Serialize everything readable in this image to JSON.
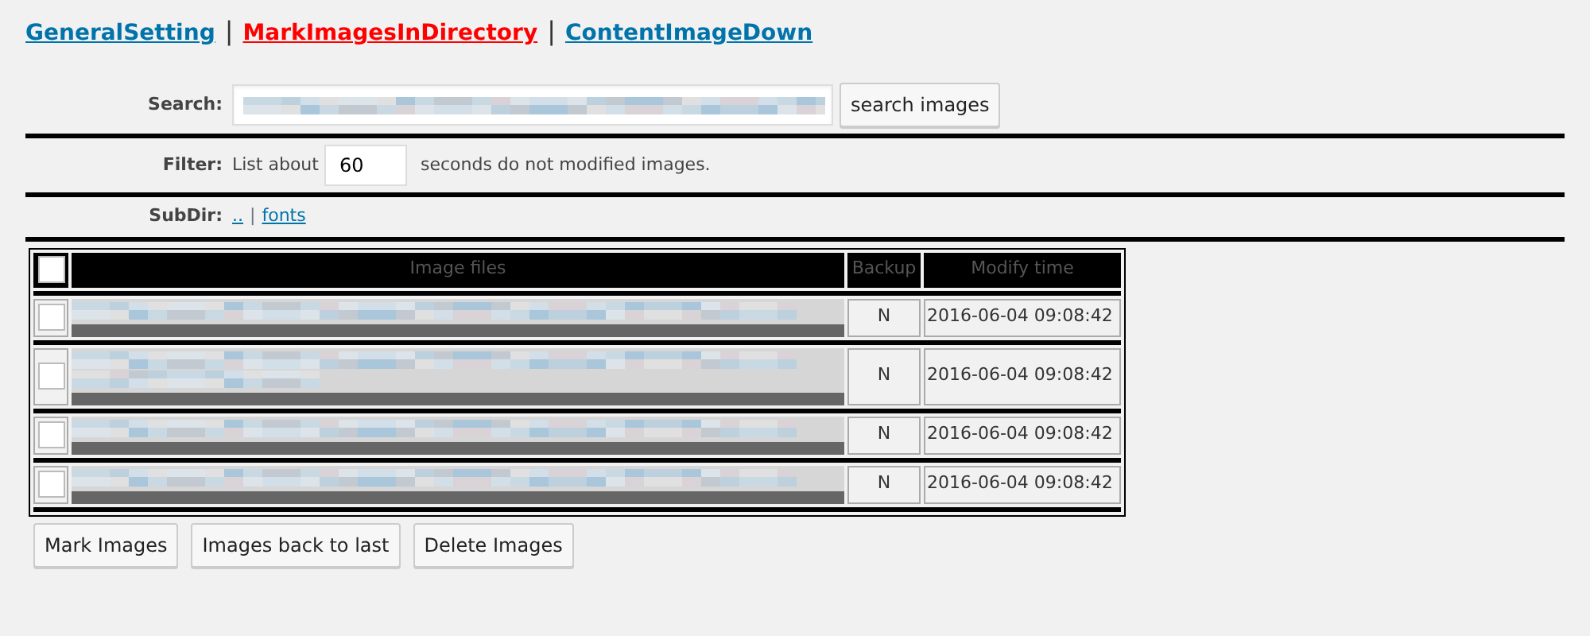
{
  "separator": "|",
  "nav_links": [
    {
      "label": "GeneralSetting",
      "selected": false
    },
    {
      "label": "MarkImagesInDirectory",
      "selected": true
    },
    {
      "label": "ContentImageDown",
      "selected": false
    }
  ],
  "search": {
    "label": "Search:",
    "button": "search images"
  },
  "filter": {
    "label": "Filter:",
    "before": "List about",
    "value": "60",
    "after": "seconds do not modified images."
  },
  "subdir": {
    "label": "SubDir:",
    "links": [
      "..",
      "fonts"
    ]
  },
  "table": {
    "select_all_checked": false,
    "columns": [
      "Image files",
      "Backup",
      "Modify time"
    ],
    "rows": [
      {
        "checked": false,
        "kind": "single",
        "backup": "N",
        "modify_time": "2016-06-04 09:08:42"
      },
      {
        "checked": false,
        "kind": "wrapped",
        "backup": "N",
        "modify_time": "2016-06-04 09:08:42"
      },
      {
        "checked": false,
        "kind": "single",
        "backup": "N",
        "modify_time": "2016-06-04 09:08:42"
      },
      {
        "checked": false,
        "kind": "single",
        "backup": "N",
        "modify_time": "2016-06-04 09:08:42"
      }
    ]
  },
  "buttons": [
    "Mark Images",
    "Images back to last",
    "Delete Images"
  ]
}
